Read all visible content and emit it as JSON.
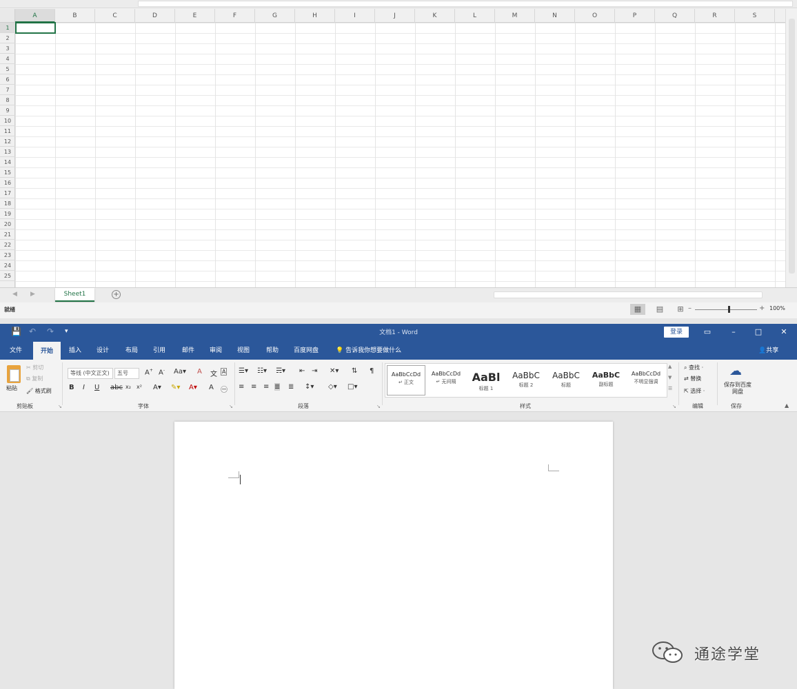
{
  "excel": {
    "columns": [
      "A",
      "B",
      "C",
      "D",
      "E",
      "F",
      "G",
      "H",
      "I",
      "J",
      "K",
      "L",
      "M",
      "N",
      "O",
      "P",
      "Q",
      "R",
      "S"
    ],
    "rows": [
      "1",
      "2",
      "3",
      "4",
      "5",
      "6",
      "7",
      "8",
      "9",
      "10",
      "11",
      "12",
      "13",
      "14",
      "15",
      "16",
      "17",
      "18",
      "19",
      "20",
      "21",
      "22",
      "23",
      "24",
      "25"
    ],
    "selected_cell": "A1",
    "sheet_tab": "Sheet1",
    "add_sheet": "+",
    "status_ready": "就绪",
    "zoom": "100%"
  },
  "word": {
    "quick_access": {
      "save": "💾",
      "undo": "↶",
      "redo": "↷",
      "customize": "▾"
    },
    "doc_title": "文档1 - Word",
    "sign_in": "登录",
    "window": {
      "ribbon_options": "▭",
      "minimize": "–",
      "restore": "□",
      "close": "✕"
    },
    "tabs": [
      "文件",
      "开始",
      "插入",
      "设计",
      "布局",
      "引用",
      "邮件",
      "审阅",
      "视图",
      "帮助",
      "百度网盘"
    ],
    "active_tab": "开始",
    "tell_me": "告诉我你想要做什么",
    "share": "共享",
    "ribbon": {
      "clipboard": {
        "paste": "粘贴",
        "cut": "✂ 剪切",
        "copy": "⧉ 复制",
        "format_painter": "🖌 格式刷",
        "label": "剪贴板"
      },
      "font": {
        "font_name": "等线 (中文正文)",
        "font_size": "五号",
        "label": "字体"
      },
      "paragraph": {
        "label": "段落"
      },
      "styles": {
        "label": "样式",
        "items": [
          {
            "sample": "AaBbCcDd",
            "name": "↵ 正文",
            "size": "8px",
            "weight": "normal"
          },
          {
            "sample": "AaBbCcDd",
            "name": "↵ 无间隔",
            "size": "8px",
            "weight": "normal"
          },
          {
            "sample": "AaBl",
            "name": "标题 1",
            "size": "16px",
            "weight": "bold"
          },
          {
            "sample": "AaBbC",
            "name": "标题 2",
            "size": "12px",
            "weight": "normal"
          },
          {
            "sample": "AaBbC",
            "name": "标题",
            "size": "12px",
            "weight": "normal"
          },
          {
            "sample": "AaBbC",
            "name": "副标题",
            "size": "11px",
            "weight": "bold"
          },
          {
            "sample": "AaBbCcDd",
            "name": "不明显强调",
            "size": "8px",
            "weight": "normal"
          }
        ]
      },
      "editing": {
        "find": "⌕ 查找 ·",
        "replace": "⇄ 替换",
        "select": "⇱ 选择 ·",
        "label": "编辑"
      },
      "voice": {
        "dictate": "保存到百度网盘",
        "label": "保存"
      }
    }
  },
  "watermark": {
    "text": "通途学堂"
  },
  "colors": {
    "word_blue": "#2b579a",
    "excel_green": "#217346"
  }
}
